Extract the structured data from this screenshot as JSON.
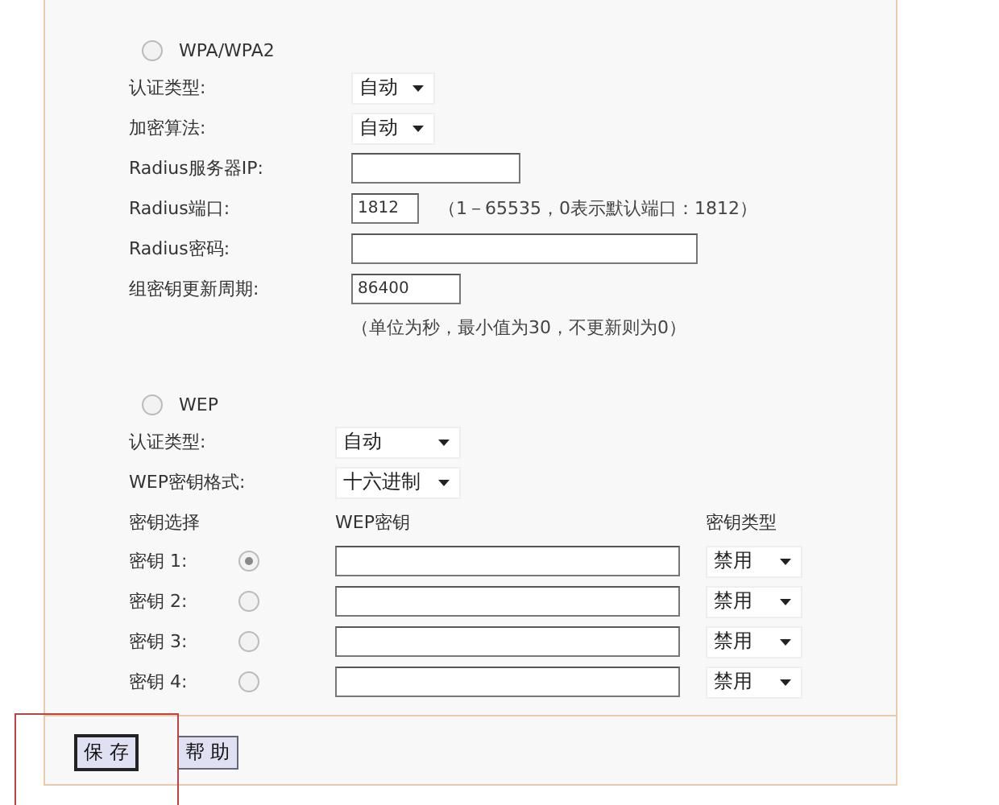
{
  "wpa": {
    "label": "WPA/WPA2",
    "selected": false,
    "fields": [
      {
        "kind": "select",
        "label": "认证类型:",
        "value": "自动"
      },
      {
        "kind": "select",
        "label": "加密算法:",
        "value": "自动"
      },
      {
        "kind": "ip",
        "label": "Radius服务器IP:"
      },
      {
        "kind": "port",
        "label": "Radius端口:",
        "value": "1812",
        "note": "（1－65535，0表示默认端口：1812）"
      },
      {
        "kind": "secret",
        "label": "Radius密码:"
      },
      {
        "kind": "period",
        "label": "组密钥更新周期:",
        "value": "86400"
      },
      {
        "kind": "note",
        "note": "（单位为秒，最小值为30，不更新则为0）"
      }
    ]
  },
  "wep": {
    "label": "WEP",
    "selected": false,
    "fields": [
      {
        "kind": "select",
        "label": "认证类型:",
        "value": "自动"
      },
      {
        "kind": "select",
        "label": "WEP密钥格式:",
        "value": "十六进制"
      }
    ],
    "headers": [
      "密钥选择",
      "WEP密钥",
      "密钥类型"
    ],
    "keys": [
      {
        "label": "密钥 1:",
        "selected": true,
        "type": "禁用"
      },
      {
        "label": "密钥 2:",
        "selected": false,
        "type": "禁用"
      },
      {
        "label": "密钥 3:",
        "selected": false,
        "type": "禁用"
      },
      {
        "label": "密钥 4:",
        "selected": false,
        "type": "禁用"
      }
    ]
  },
  "buttons": [
    {
      "label": "保 存",
      "focused": true
    },
    {
      "label": "帮 助",
      "focused": false
    }
  ]
}
